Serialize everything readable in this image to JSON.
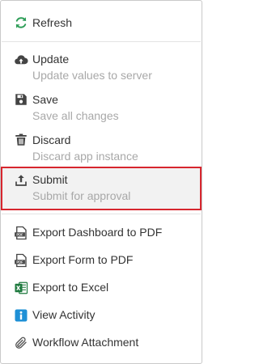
{
  "menu": {
    "items": [
      {
        "label": "Refresh",
        "icon": "refresh-icon"
      },
      {
        "label": "Update",
        "sub": "Update values to server",
        "icon": "cloud-upload-icon"
      },
      {
        "label": "Save",
        "sub": "Save all changes",
        "icon": "floppy-disk-icon"
      },
      {
        "label": "Discard",
        "sub": "Discard app instance",
        "icon": "trash-icon"
      },
      {
        "label": "Submit",
        "sub": "Submit for approval",
        "icon": "upload-icon"
      },
      {
        "label": "Export Dashboard to PDF",
        "icon": "pdf-icon"
      },
      {
        "label": "Export Form to PDF",
        "icon": "pdf-icon"
      },
      {
        "label": "Export to Excel",
        "icon": "excel-icon"
      },
      {
        "label": "View Activity",
        "icon": "info-icon"
      },
      {
        "label": "Workflow Attachment",
        "icon": "paperclip-icon"
      }
    ]
  },
  "colors": {
    "refresh": "#2e9e58",
    "icon_dark": "#444444",
    "excel": "#1f7a3f",
    "info": "#1e90d6",
    "highlight_border": "#d7262e"
  }
}
